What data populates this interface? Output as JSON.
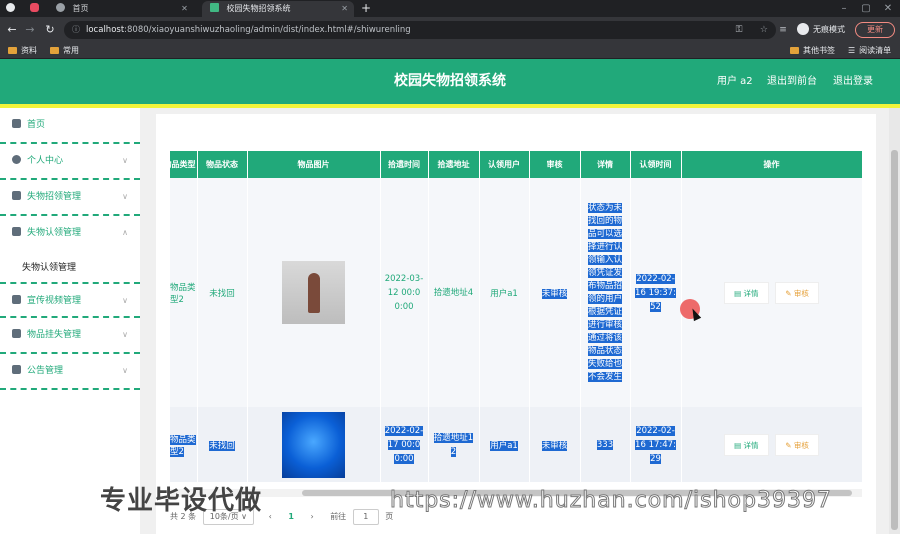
{
  "browser": {
    "tabs": [
      {
        "label": ""
      },
      {
        "label": "首页"
      },
      {
        "label": "校园失物招领系统"
      }
    ],
    "url_host": "localhost",
    "url_rest": ":8080/xiaoyuanshiwuzhaoling/admin/dist/index.html#/shiwurenling",
    "incognito_label": "无痕模式",
    "update_label": "更新",
    "bookmarks": [
      "资料",
      "常用"
    ],
    "other_bookmarks": "其他书签",
    "reading_list": "阅读清单"
  },
  "header": {
    "title": "校园失物招领系统",
    "user": "用户 a2",
    "to_front": "退出到前台",
    "logout": "退出登录"
  },
  "sidebar": {
    "items": [
      {
        "label": "首页"
      },
      {
        "label": "个人中心"
      },
      {
        "label": "失物招领管理"
      },
      {
        "label": "失物认领管理"
      },
      {
        "label": "宣传视频管理"
      },
      {
        "label": "物品挂失管理"
      },
      {
        "label": "公告管理"
      }
    ],
    "sub_item": "失物认领管理"
  },
  "table": {
    "headers": [
      "物品类型",
      "物品状态",
      "物品图片",
      "拾遗时间",
      "拾遗地址",
      "认领用户",
      "审核",
      "详情",
      "认领时间",
      "操作"
    ],
    "rows": [
      {
        "type": "物品类型2",
        "status": "未找回",
        "pick_time": "2022-03-12 00:00:00",
        "address": "拾遗地址4",
        "user": "用户a1",
        "audit": "未审核",
        "detail": "状态为未找回的物品可以选择进行认领输入认领凭证发布物品招领的用户根据凭证进行审核通过将该物品状态失败给也不会发生",
        "claim_time": "2022-02-16 19:37:52"
      },
      {
        "type": "物品类型2",
        "status": "未找回",
        "pick_time": "2022-02-17 00:00:00",
        "address": "拾遗地址12",
        "user": "用户a1",
        "audit": "未审核",
        "detail": "333",
        "claim_time": "2022-02-16 17:47:29"
      }
    ],
    "op_detail": "详情",
    "op_audit": "审核"
  },
  "pager": {
    "total": "共 2 条",
    "page_size": "10条/页",
    "current": "1",
    "goto_prefix": "前往",
    "goto_value": "1",
    "goto_suffix": "页"
  },
  "watermarks": {
    "left": "专业毕设代做",
    "right": "https://www.huzhan.com/ishop39397"
  },
  "colors": {
    "accent": "#21a97a",
    "highlight": "#f2f43a",
    "selection": "#1e69d2"
  }
}
